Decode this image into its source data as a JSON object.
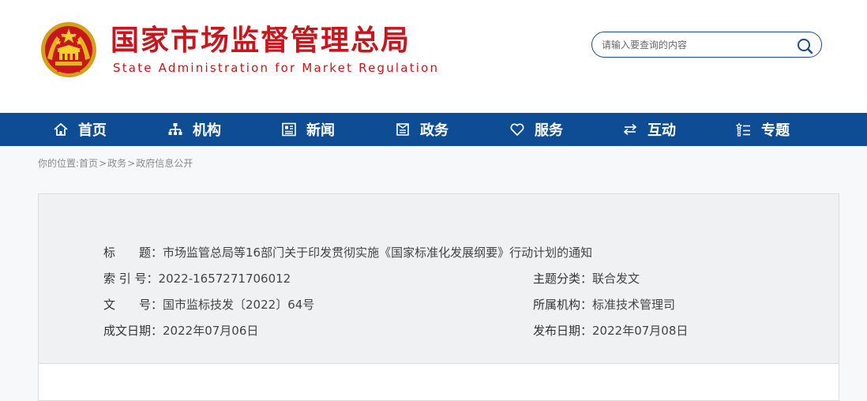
{
  "header": {
    "title": "国家市场监督管理总局",
    "subtitle": "State Administration for Market Regulation",
    "brand_color": "#c8161d"
  },
  "search": {
    "placeholder": "请输入要查询的内容",
    "icon": "search-icon"
  },
  "nav": {
    "bg_color": "#0e4c94",
    "items": [
      {
        "label": "首页",
        "icon": "home-icon"
      },
      {
        "label": "机构",
        "icon": "org-chart-icon"
      },
      {
        "label": "新闻",
        "icon": "newspaper-icon"
      },
      {
        "label": "政务",
        "icon": "document-icon"
      },
      {
        "label": "服务",
        "icon": "heart-icon"
      },
      {
        "label": "互动",
        "icon": "swap-arrows-icon"
      },
      {
        "label": "专题",
        "icon": "list-icon"
      }
    ]
  },
  "breadcrumb": {
    "prefix": "你的位置:",
    "items": [
      "首页",
      "政务",
      "政府信息公开"
    ],
    "separator": ">"
  },
  "document_meta": {
    "title_label": "标　　题：",
    "title_value": "市场监管总局等16部门关于印发贯彻实施《国家标准化发展纲要》行动计划的通知",
    "index_label": "索 引 号：",
    "index_value": "2022-1657271706012",
    "topic_label": "主题分类：",
    "topic_value": "联合发文",
    "doc_no_label": "文　　号：",
    "doc_no_value": "国市监标技发〔2022〕64号",
    "org_label": "所属机构：",
    "org_value": "标准技术管理司",
    "created_label": "成文日期：",
    "created_value": "2022年07月06日",
    "published_label": "发布日期：",
    "published_value": "2022年07月08日"
  }
}
